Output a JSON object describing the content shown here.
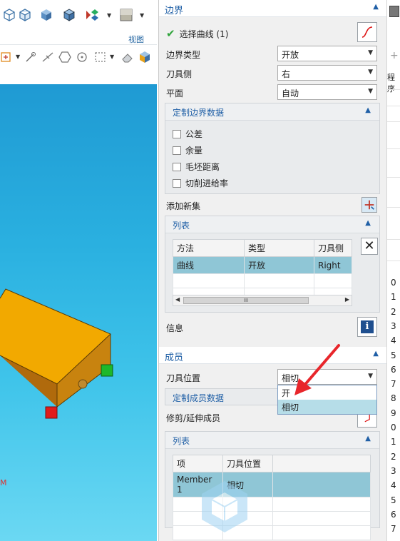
{
  "toolbar": {
    "view_label": "视图",
    "icons": [
      "wireframe-box-icon",
      "hidden-edge-box-icon",
      "shaded-box-icon",
      "shaded-edges-box-icon",
      "render-style-icon",
      "background-icon"
    ]
  },
  "viewport": {
    "csys_label": "M"
  },
  "dialog": {
    "boundary": {
      "title": "边界",
      "select_curve_label": "选择曲线 (1)",
      "boundary_type_label": "边界类型",
      "boundary_type_value": "开放",
      "tool_side_label": "刀具侧",
      "tool_side_value": "右",
      "plane_label": "平面",
      "plane_value": "自动",
      "custom_data": {
        "title": "定制边界数据",
        "checks": [
          "公差",
          "余量",
          "毛坯距离",
          "切削进给率"
        ]
      },
      "add_new_set_label": "添加新集",
      "list": {
        "title": "列表",
        "columns": [
          "方法",
          "类型",
          "刀具侧"
        ],
        "rows": [
          [
            "曲线",
            "开放",
            "Right"
          ]
        ],
        "scroll_thumb_text": "III"
      },
      "info_label": "信息"
    },
    "members": {
      "title": "成员",
      "tool_position_label": "刀具位置",
      "tool_position_value": "相切",
      "dropdown_options": [
        "开",
        "相切"
      ],
      "custom_member_data_label": "定制成员数据",
      "trim_extend_label": "修剪/延伸成员",
      "list": {
        "title": "列表",
        "columns": [
          "项",
          "刀具位置"
        ],
        "rows": [
          [
            "Member 1",
            "相切"
          ]
        ]
      }
    }
  },
  "right_strip": {
    "header_text": "程序",
    "numbers": [
      "0",
      "1",
      "2",
      "3",
      "4",
      "5",
      "6",
      "7",
      "8",
      "9",
      "0",
      "1",
      "2",
      "3",
      "4",
      "5",
      "6",
      "7"
    ]
  },
  "colors": {
    "accent_blue": "#1f5fa6",
    "selection_row": "#8fc6d6",
    "part_orange": "#f2a900",
    "red_arrow": "#e8262b"
  }
}
